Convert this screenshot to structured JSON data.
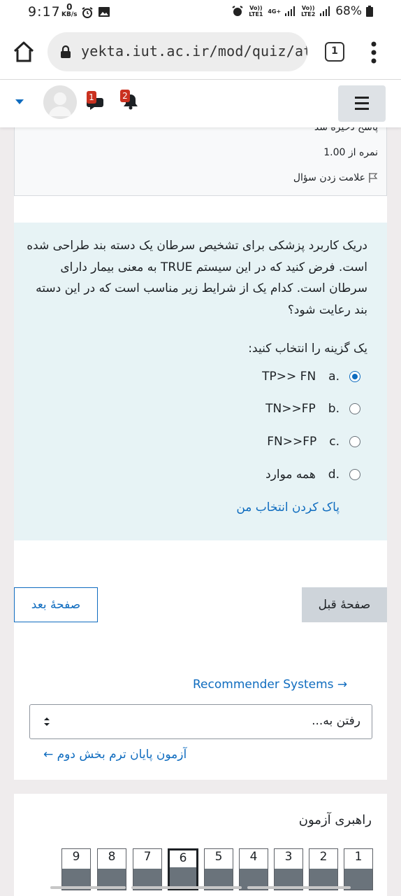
{
  "status_bar": {
    "time": "9:17",
    "kb_value": "0",
    "kb_unit": "KB/s",
    "net1": "Vo)) LTE1",
    "net1_gen": "4G+",
    "net2": "Vo)) LTE2",
    "battery": "68%"
  },
  "browser": {
    "url": "yekta.iut.ac.ir/mod/quiz/atte",
    "tab_count": "1"
  },
  "navbar": {
    "messages_count": "1",
    "notifications_count": "2"
  },
  "info": {
    "status": "پاسخ ذخیره شد",
    "grade": "نمره از 1.00",
    "flag_label": "علامت زدن سؤال"
  },
  "question": {
    "text": "دریک کاربرد پزشکی برای تشخیص سرطان یک دسته بند طراحی شده است. فرض کنید که در این سیستم TRUE به معنی بیمار دارای سرطان است. کدام یک از شرایط زیر مناسب است که در این دسته بند رعایت شود؟",
    "prompt": "یک گزینه را انتخاب کنید:",
    "options": [
      {
        "letter": "a.",
        "text": "TP>> FN",
        "selected": true
      },
      {
        "letter": "b.",
        "text": "TN>>FP",
        "selected": false
      },
      {
        "letter": "c.",
        "text": "FN>>FP",
        "selected": false
      },
      {
        "letter": "d.",
        "text": "همه موارد",
        "selected": false
      }
    ],
    "clear_label": "پاک کردن انتخاب من"
  },
  "buttons": {
    "prev": "صفحهٔ قبل",
    "next": "صفحهٔ بعد"
  },
  "activity_nav": {
    "next_activity": "Recommender Systems →",
    "jump_placeholder": "رفتن به...",
    "prev_activity": "آزمون پایان ترم بخش دوم ←"
  },
  "quiz_nav": {
    "title": "راهبری آزمون",
    "questions": [
      "1",
      "2",
      "3",
      "4",
      "5",
      "6",
      "7",
      "8",
      "9"
    ],
    "current": "6"
  },
  "colors": {
    "link": "#0f6cbf",
    "question_bg": "#e7f3f5",
    "badge": "#ca3120"
  }
}
